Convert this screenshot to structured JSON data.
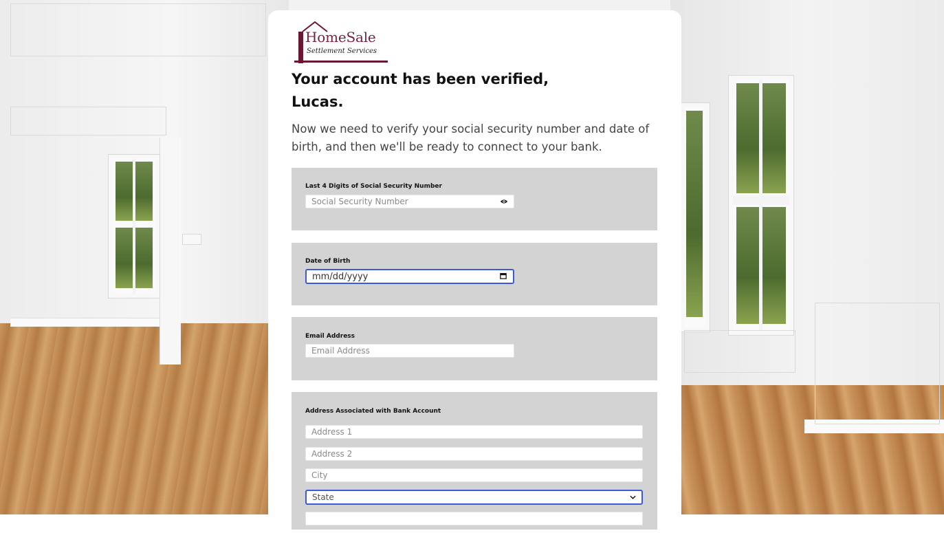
{
  "brand": {
    "name": "HomeSale",
    "tagline": "Settlement Services",
    "color": "#7a1f3e"
  },
  "heading": {
    "line1": "Your account has been verified,",
    "line2": "Lucas."
  },
  "subtitle": "Now we need to verify your social security number and date of birth, and then we'll be ready to connect to your bank.",
  "ssn_section": {
    "label": "Last 4 Digits of Social Security Number",
    "placeholder": "Social Security Number",
    "toggle_icon": "eye-icon"
  },
  "dob_section": {
    "label": "Date of Birth",
    "placeholder": "mm/dd/yyyy",
    "picker_icon": "calendar-icon"
  },
  "email_section": {
    "label": "Email Address",
    "placeholder": "Email Address"
  },
  "address_section": {
    "label": "Address Associated with Bank Account",
    "address1_placeholder": "Address 1",
    "address2_placeholder": "Address 2",
    "city_placeholder": "City",
    "state_selected": "State",
    "state_icon": "chevron-down-icon"
  },
  "colors": {
    "focus_border": "#3d5ad6",
    "section_bg": "#d3d3d3"
  }
}
